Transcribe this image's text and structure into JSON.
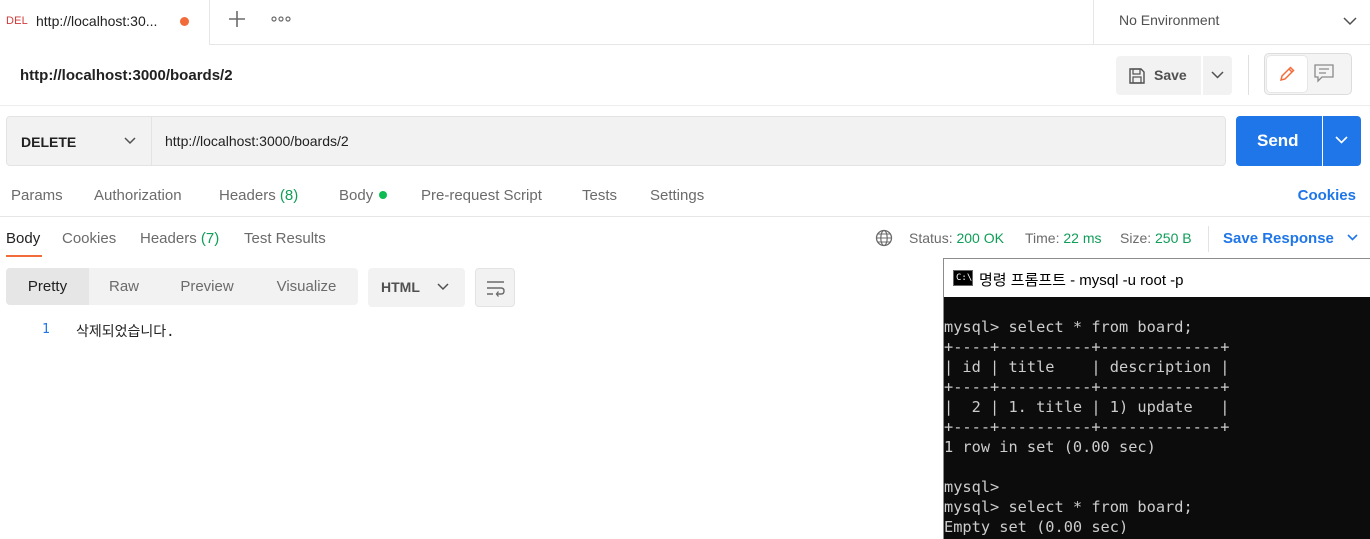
{
  "tab": {
    "method_badge": "DEL",
    "title": "http://localhost:30...",
    "unsaved_color": "#f26b3a"
  },
  "environment": {
    "label": "No Environment"
  },
  "request": {
    "name": "http://localhost:3000/boards/2",
    "save_label": "Save",
    "method": "DELETE",
    "url": "http://localhost:3000/boards/2",
    "send_label": "Send"
  },
  "request_tabs": [
    {
      "label": "Params",
      "count": ""
    },
    {
      "label": "Authorization",
      "count": ""
    },
    {
      "label": "Headers",
      "count": "(8)"
    },
    {
      "label": "Body",
      "count": ""
    },
    {
      "label": "Pre-request Script",
      "count": ""
    },
    {
      "label": "Tests",
      "count": ""
    },
    {
      "label": "Settings",
      "count": ""
    }
  ],
  "cookies_link": "Cookies",
  "response_tabs": [
    {
      "label": "Body",
      "count": ""
    },
    {
      "label": "Cookies",
      "count": ""
    },
    {
      "label": "Headers",
      "count": "(7)"
    },
    {
      "label": "Test Results",
      "count": ""
    }
  ],
  "response_status": {
    "status_label": "Status:",
    "status_value": "200 OK",
    "time_label": "Time:",
    "time_value": "22 ms",
    "size_label": "Size:",
    "size_value": "250 B",
    "save_response": "Save Response"
  },
  "view_tabs": [
    "Pretty",
    "Raw",
    "Preview",
    "Visualize"
  ],
  "format": "HTML",
  "output": {
    "line_number": "1",
    "text": "삭제되었습니다."
  },
  "cmd_window": {
    "icon_text": "C:\\",
    "title": "명령 프롬프트 - mysql  -u root -p",
    "lines": [
      "mysql> select * from board;",
      "+----+----------+-------------+",
      "| id | title    | description |",
      "+----+----------+-------------+",
      "|  2 | 1. title | 1) update   |",
      "+----+----------+-------------+",
      "1 row in set (0.00 sec)",
      "",
      "mysql>",
      "mysql> select * from board;",
      "Empty set (0.00 sec)"
    ]
  },
  "colors": {
    "accent": "#1f76e8",
    "success": "#0f9d58",
    "active_underline": "#f26b3a"
  }
}
